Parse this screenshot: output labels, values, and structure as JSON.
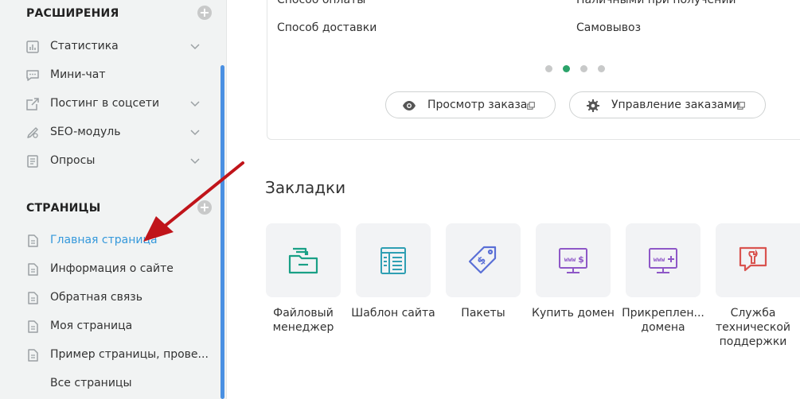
{
  "sidebar": {
    "sections": [
      {
        "title": "РАСШИРЕНИЯ",
        "items": [
          {
            "label": "Статистика",
            "icon": "chart-icon",
            "chevron": true
          },
          {
            "label": "Мини-чат",
            "icon": "chat-icon",
            "chevron": false
          },
          {
            "label": "Постинг в соцсети",
            "icon": "share-icon",
            "chevron": true
          },
          {
            "label": "SEO-модуль",
            "icon": "seo-icon",
            "chevron": true
          },
          {
            "label": "Опросы",
            "icon": "poll-icon",
            "chevron": true
          }
        ]
      },
      {
        "title": "СТРАНИЦЫ",
        "items": [
          {
            "label": "Главная страница",
            "icon": "page-icon",
            "active": true
          },
          {
            "label": "Информация о сайте",
            "icon": "page-icon"
          },
          {
            "label": "Обратная связь",
            "icon": "page-icon"
          },
          {
            "label": "Моя страница",
            "icon": "page-icon"
          },
          {
            "label": "Пример страницы, прове...",
            "icon": "page-icon"
          },
          {
            "label": "Все страницы",
            "icon": ""
          }
        ]
      }
    ]
  },
  "order_card": {
    "rows": [
      {
        "label": "Способ оплаты",
        "value": "Наличными при получении"
      },
      {
        "label": "Способ доставки",
        "value": "Самовывоз"
      }
    ],
    "dots": {
      "count": 4,
      "active_index": 1
    },
    "buttons": [
      {
        "label": "Просмотр заказа",
        "icon": "eye-icon"
      },
      {
        "label": "Управление заказами",
        "icon": "gear-icon"
      }
    ]
  },
  "bookmarks": {
    "title": "Закладки",
    "tiles": [
      {
        "label": "Файловый менеджер",
        "icon": "folder-icon",
        "color": "#1aa086"
      },
      {
        "label": "Шаблон сайта",
        "icon": "template-icon",
        "color": "#2f9fb3"
      },
      {
        "label": "Пакеты",
        "icon": "price-tag-icon",
        "color": "#5a6fd6"
      },
      {
        "label": "Купить домен",
        "icon": "domain-buy-icon",
        "color": "#8e57c7"
      },
      {
        "label": "Прикреплен... домена",
        "icon": "domain-attach-icon",
        "color": "#8e57c7"
      },
      {
        "label": "Служба технической поддержки",
        "icon": "support-icon",
        "color": "#d9534f"
      }
    ]
  },
  "colors": {
    "accent": "#3498db",
    "scrollbar": "#4a90e2",
    "arrow": "#c0141a",
    "active_dot": "#2ba36a"
  }
}
